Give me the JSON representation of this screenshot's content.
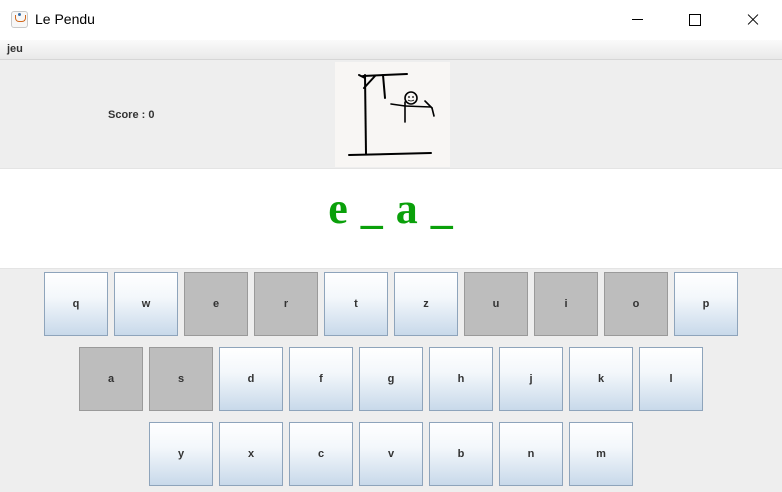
{
  "window": {
    "title": "Le Pendu"
  },
  "menu": {
    "jeu": "jeu"
  },
  "score": {
    "label": "Score : 0"
  },
  "word": {
    "display": "e _ a _"
  },
  "colors": {
    "word": "#0aa00a",
    "key_used": "#bdbdbd"
  },
  "keyboard": {
    "row1": [
      {
        "label": "q",
        "used": false
      },
      {
        "label": "w",
        "used": false
      },
      {
        "label": "e",
        "used": true
      },
      {
        "label": "r",
        "used": true
      },
      {
        "label": "t",
        "used": false
      },
      {
        "label": "z",
        "used": false
      },
      {
        "label": "u",
        "used": true
      },
      {
        "label": "i",
        "used": true
      },
      {
        "label": "o",
        "used": true
      },
      {
        "label": "p",
        "used": false
      }
    ],
    "row2": [
      {
        "label": "a",
        "used": true
      },
      {
        "label": "s",
        "used": true
      },
      {
        "label": "d",
        "used": false
      },
      {
        "label": "f",
        "used": false
      },
      {
        "label": "g",
        "used": false
      },
      {
        "label": "h",
        "used": false
      },
      {
        "label": "j",
        "used": false
      },
      {
        "label": "k",
        "used": false
      },
      {
        "label": "l",
        "used": false
      }
    ],
    "row3": [
      {
        "label": "y",
        "used": false
      },
      {
        "label": "x",
        "used": false
      },
      {
        "label": "c",
        "used": false
      },
      {
        "label": "v",
        "used": false
      },
      {
        "label": "b",
        "used": false
      },
      {
        "label": "n",
        "used": false
      },
      {
        "label": "m",
        "used": false
      }
    ]
  }
}
